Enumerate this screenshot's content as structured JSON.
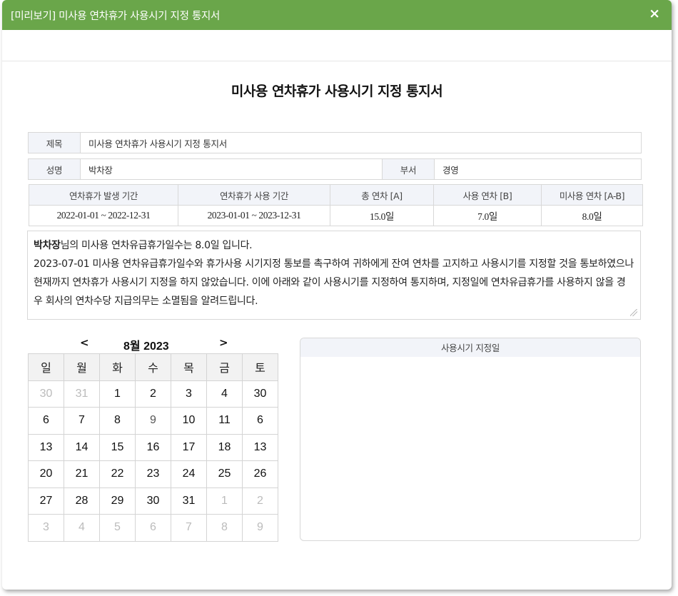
{
  "window": {
    "title": "[미리보기] 미사용 연차휴가 사용시기 지정 통지서",
    "close_icon": "×"
  },
  "document": {
    "title": "미사용 연차휴가 사용시기 지정 통지서",
    "subject_label": "제목",
    "subject_value": "미사용 연차휴가 사용시기 지정 통지서",
    "name_label": "성명",
    "name_value": "박차장",
    "dept_label": "부서",
    "dept_value": "경영"
  },
  "summary": {
    "headers": [
      "연차휴가 발생 기간",
      "연차휴가 사용 기간",
      "총 연차 [A]",
      "사용 연차 [B]",
      "미사용 연차 [A-B]"
    ],
    "values": [
      "2022-01-01 ~ 2022-12-31",
      "2023-01-01 ~ 2023-12-31",
      "15.0일",
      "7.0일",
      "8.0일"
    ]
  },
  "notice": {
    "name": "박차장",
    "line1_mid": "님의 미사용 연차유급휴가일수는 ",
    "days": "8.0",
    "line1_end": "일 입니다.",
    "date": "2023-07-01",
    "body": " 미사용 연차유급휴가일수와 휴가사용 시기지정 통보를 촉구하여 귀하에게 잔여 연차를 고지하고 사용시기를 지정할 것을 통보하였으나 현재까지 연차휴가 사용시기 지정을 하지 않았습니다. 이에 아래와 같이 사용시기를 지정하여 통지하며, 지정일에 연차유급휴가를 사용하지 않을 경우 회사의 연차수당 지급의무는 소멸됨을 알려드립니다."
  },
  "calendar": {
    "prev": "<",
    "next": ">",
    "month_label": "8월 2023",
    "weekdays": [
      "일",
      "월",
      "화",
      "수",
      "목",
      "금",
      "토"
    ],
    "weeks": [
      [
        {
          "d": "30",
          "s": "dim"
        },
        {
          "d": "31",
          "s": "dim"
        },
        {
          "d": "1",
          "s": ""
        },
        {
          "d": "2",
          "s": ""
        },
        {
          "d": "3",
          "s": ""
        },
        {
          "d": "4",
          "s": ""
        },
        {
          "d": "30",
          "s": ""
        }
      ],
      [
        {
          "d": "6",
          "s": ""
        },
        {
          "d": "7",
          "s": ""
        },
        {
          "d": "8",
          "s": ""
        },
        {
          "d": "9",
          "s": "mid"
        },
        {
          "d": "10",
          "s": ""
        },
        {
          "d": "11",
          "s": ""
        },
        {
          "d": "6",
          "s": ""
        }
      ],
      [
        {
          "d": "13",
          "s": ""
        },
        {
          "d": "14",
          "s": ""
        },
        {
          "d": "15",
          "s": ""
        },
        {
          "d": "16",
          "s": ""
        },
        {
          "d": "17",
          "s": ""
        },
        {
          "d": "18",
          "s": ""
        },
        {
          "d": "13",
          "s": ""
        }
      ],
      [
        {
          "d": "20",
          "s": ""
        },
        {
          "d": "21",
          "s": ""
        },
        {
          "d": "22",
          "s": ""
        },
        {
          "d": "23",
          "s": ""
        },
        {
          "d": "24",
          "s": ""
        },
        {
          "d": "25",
          "s": ""
        },
        {
          "d": "26",
          "s": ""
        }
      ],
      [
        {
          "d": "27",
          "s": ""
        },
        {
          "d": "28",
          "s": ""
        },
        {
          "d": "29",
          "s": ""
        },
        {
          "d": "30",
          "s": ""
        },
        {
          "d": "31",
          "s": ""
        },
        {
          "d": "1",
          "s": "dim"
        },
        {
          "d": "2",
          "s": "dim"
        }
      ],
      [
        {
          "d": "3",
          "s": "dim"
        },
        {
          "d": "4",
          "s": "dim"
        },
        {
          "d": "5",
          "s": "dim"
        },
        {
          "d": "6",
          "s": "dim"
        },
        {
          "d": "7",
          "s": "dim"
        },
        {
          "d": "8",
          "s": "dim"
        },
        {
          "d": "9",
          "s": "dim"
        }
      ]
    ]
  },
  "side_panel": {
    "header": "사용시기 지정일"
  },
  "colors": {
    "titlebar": "#6aa64a",
    "label_bg": "#f2f4f9"
  }
}
